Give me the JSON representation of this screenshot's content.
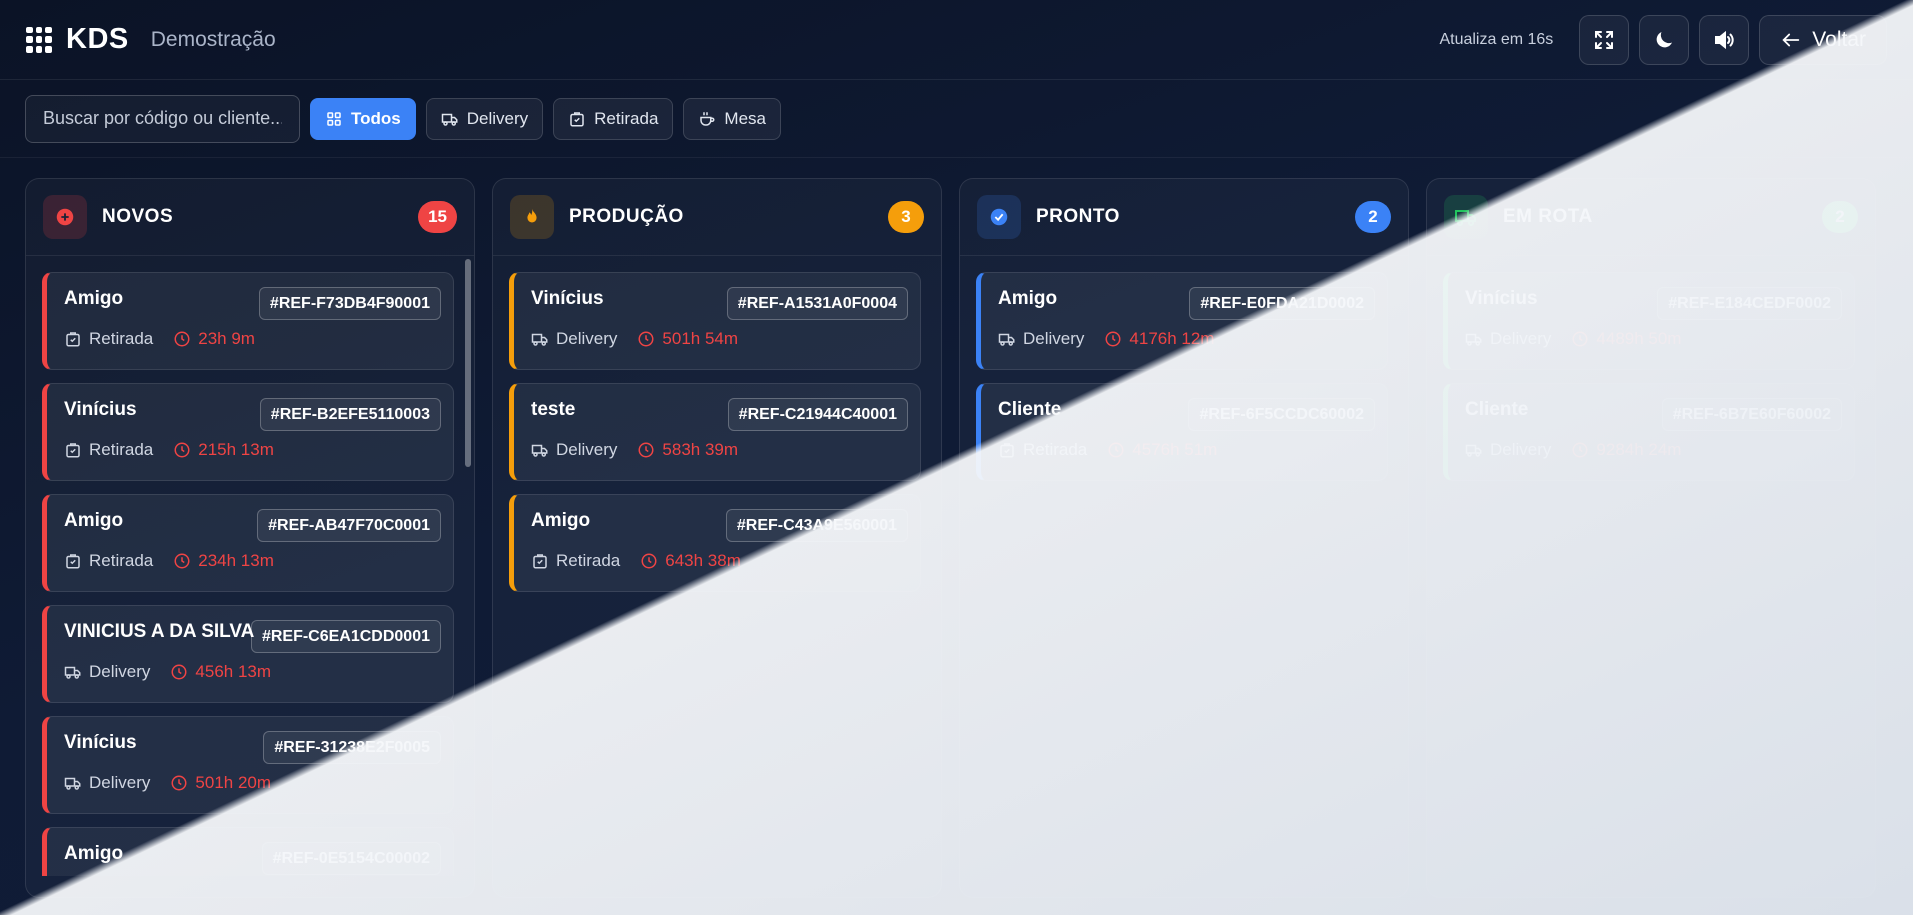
{
  "header": {
    "brand": "KDS",
    "subtitle": "Demostração",
    "refresh_text": "Atualiza em 16s",
    "back_label": "Voltar"
  },
  "filters": {
    "search_placeholder": "Buscar por código ou cliente...",
    "items": [
      {
        "label": "Todos",
        "icon": "grid-icon",
        "active": true
      },
      {
        "label": "Delivery",
        "icon": "truck-icon",
        "active": false
      },
      {
        "label": "Retirada",
        "icon": "bag-icon",
        "active": false
      },
      {
        "label": "Mesa",
        "icon": "cup-icon",
        "active": false
      }
    ]
  },
  "columns": [
    {
      "title": "NOVOS",
      "count": "15",
      "accent": "#ef4444",
      "icon": "plus-circle-icon",
      "cards": [
        {
          "name": "Amigo",
          "ref": "#REF-F73DB4F90001",
          "type": "Retirada",
          "time": "23h 9m"
        },
        {
          "name": "Vinícius",
          "ref": "#REF-B2EFE5110003",
          "type": "Retirada",
          "time": "215h 13m"
        },
        {
          "name": "Amigo",
          "ref": "#REF-AB47F70C0001",
          "type": "Retirada",
          "time": "234h 13m"
        },
        {
          "name": "VINICIUS A DA SILVA",
          "ref": "#REF-C6EA1CDD0001",
          "type": "Delivery",
          "time": "456h 13m"
        },
        {
          "name": "Vinícius",
          "ref": "#REF-31238E2F0005",
          "type": "Delivery",
          "time": "501h 20m"
        },
        {
          "name": "Amigo",
          "ref": "#REF-0E5154C00002",
          "type": "Delivery",
          "time": ""
        }
      ]
    },
    {
      "title": "PRODUÇÃO",
      "count": "3",
      "accent": "#f59e0b",
      "icon": "flame-icon",
      "cards": [
        {
          "name": "Vinícius",
          "ref": "#REF-A1531A0F0004",
          "type": "Delivery",
          "time": "501h 54m"
        },
        {
          "name": "teste",
          "ref": "#REF-C21944C40001",
          "type": "Delivery",
          "time": "583h 39m"
        },
        {
          "name": "Amigo",
          "ref": "#REF-C43A9E560001",
          "type": "Retirada",
          "time": "643h 38m"
        }
      ]
    },
    {
      "title": "PRONTO",
      "count": "2",
      "accent": "#3b82f6",
      "icon": "check-circle-icon",
      "cards": [
        {
          "name": "Amigo",
          "ref": "#REF-E0FDA21D0002",
          "type": "Delivery",
          "time": "4176h 12m"
        },
        {
          "name": "Cliente",
          "ref": "#REF-6F5CCDC60002",
          "type": "Retirada",
          "time": "4576h 51m"
        }
      ]
    },
    {
      "title": "EM ROTA",
      "count": "2",
      "accent": "#22c55e",
      "icon": "truck-icon",
      "cards": [
        {
          "name": "Vinícius",
          "ref": "#REF-E184CEDF0002",
          "type": "Delivery",
          "time": "4489h 50m"
        },
        {
          "name": "Cliente",
          "ref": "#REF-6B7E60F60002",
          "type": "Delivery",
          "time": "9284h 24m"
        }
      ]
    }
  ]
}
